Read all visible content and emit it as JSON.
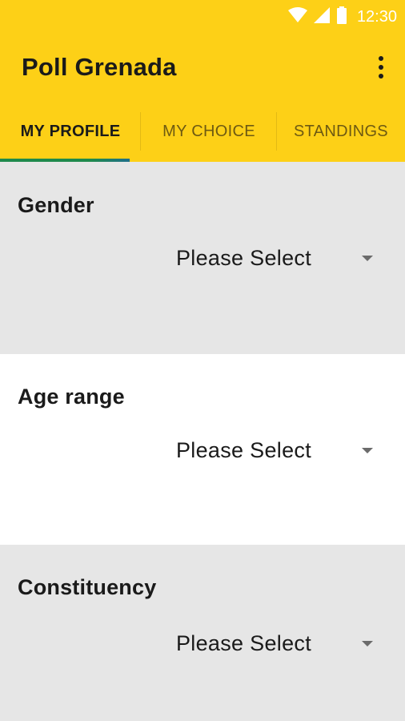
{
  "status_bar": {
    "time": "12:30",
    "icons": [
      "wifi-icon",
      "cell-signal-icon",
      "battery-icon"
    ]
  },
  "app_bar": {
    "title": "Poll Grenada",
    "menu_icon": "more-vertical-icon"
  },
  "tabs": [
    {
      "label": "MY PROFILE",
      "active": true
    },
    {
      "label": "MY CHOICE",
      "active": false
    },
    {
      "label": "STANDINGS",
      "active": false
    }
  ],
  "form": {
    "gender": {
      "label": "Gender",
      "value": "Please Select"
    },
    "age_range": {
      "label": "Age range",
      "value": "Please Select"
    },
    "constituency": {
      "label": "Constituency",
      "value": "Please Select"
    }
  },
  "colors": {
    "primary": "#fdd017",
    "indicator": "#1f8a4c",
    "grey_section": "#e6e6e6",
    "white_section": "#ffffff"
  }
}
